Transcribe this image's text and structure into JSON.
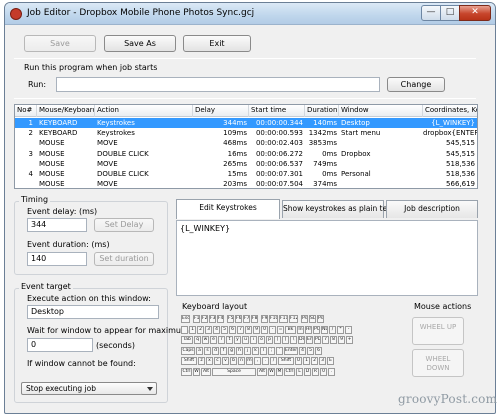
{
  "window": {
    "title": "Job Editor - Dropbox Mobile Phone Photos Sync.gcj",
    "minimize_glyph": "—",
    "maximize_glyph": "□",
    "close_glyph": "✕"
  },
  "toolbar": {
    "save_label": "Save",
    "save_as_label": "Save As",
    "exit_label": "Exit"
  },
  "run": {
    "section_label": "Run this program when job starts",
    "run_label": "Run:",
    "run_value": "",
    "change_label": "Change"
  },
  "table": {
    "columns": [
      "No#",
      "Mouse/Keyboard",
      "Action",
      "Delay",
      "Start time",
      "Duration",
      "Window",
      "Coordinates, Keys"
    ],
    "rows": [
      {
        "no": "1",
        "device": "KEYBOARD",
        "action": "Keystrokes",
        "delay": "344ms",
        "start": "00:00:00.344",
        "duration": "140ms",
        "window": "Desktop",
        "coords": "{L_WINKEY}"
      },
      {
        "no": "2",
        "device": "KEYBOARD",
        "action": "Keystrokes",
        "delay": "109ms",
        "start": "00:00:00.593",
        "duration": "1342ms",
        "window": "Start menu",
        "coords": "dropbox{ENTER}"
      },
      {
        "no": "",
        "device": "MOUSE",
        "action": "MOVE",
        "delay": "468ms",
        "start": "00:00:02.403",
        "duration": "3853ms",
        "window": "",
        "coords": "545,515"
      },
      {
        "no": "3",
        "device": "MOUSE",
        "action": "DOUBLE CLICK",
        "delay": "16ms",
        "start": "00:00:06.272",
        "duration": "0ms",
        "window": "Dropbox",
        "coords": "545,515"
      },
      {
        "no": "",
        "device": "MOUSE",
        "action": "MOVE",
        "delay": "265ms",
        "start": "00:00:06.537",
        "duration": "749ms",
        "window": "",
        "coords": "518,536"
      },
      {
        "no": "4",
        "device": "MOUSE",
        "action": "DOUBLE CLICK",
        "delay": "15ms",
        "start": "00:00:07.301",
        "duration": "0ms",
        "window": "Personal",
        "coords": "518,536"
      },
      {
        "no": "",
        "device": "MOUSE",
        "action": "MOVE",
        "delay": "203ms",
        "start": "00:00:07.504",
        "duration": "374ms",
        "window": "",
        "coords": "566,619"
      }
    ]
  },
  "timing": {
    "group_label": "Timing",
    "event_delay_label": "Event delay: (ms)",
    "event_delay_value": "344",
    "set_delay_label": "Set Delay",
    "event_duration_label": "Event duration: (ms)",
    "event_duration_value": "140",
    "set_duration_label": "Set duration"
  },
  "target": {
    "group_label": "Event target",
    "execute_label": "Execute action on this window:",
    "window_value": "Desktop",
    "wait_label": "Wait for window to appear for maximum:",
    "wait_value": "0",
    "seconds_label": "(seconds)",
    "not_found_label": "If window cannot be found:",
    "not_found_value": "Stop executing job"
  },
  "tabs": [
    "Edit Keystrokes",
    "Show keystrokes as plain text",
    "Job description"
  ],
  "keystrokes_text": "{L_WINKEY}",
  "keyboard": {
    "label": "Keyboard layout",
    "row1": [
      "Esc",
      "F1",
      "F2",
      "F3",
      "F4",
      "F5",
      "F6",
      "F7",
      "F8",
      "F9",
      "F10",
      "F11",
      "F12",
      "Ps",
      "SL",
      "Ps"
    ],
    "row2": [
      "`",
      "1",
      "2",
      "3",
      "4",
      "5",
      "6",
      "7",
      "8",
      "9",
      "0",
      "-",
      "=",
      "Bk",
      "In",
      "Hm",
      "PU",
      "NL",
      "/",
      "*",
      "-"
    ],
    "row3": [
      "Tab",
      "q",
      "w",
      "e",
      "r",
      "t",
      "y",
      "u",
      "i",
      "o",
      "p",
      "[",
      "]",
      "\\",
      "De",
      "En",
      "PD",
      "7",
      "8",
      "9",
      "+"
    ],
    "row4": [
      "Caps",
      "a",
      "s",
      "d",
      "f",
      "g",
      "h",
      "j",
      "k",
      "l",
      ";",
      "'",
      "Enter",
      "4",
      "5",
      "6"
    ],
    "row5": [
      "Shift",
      "z",
      "x",
      "c",
      "v",
      "b",
      "n",
      "m",
      ",",
      ".",
      "/",
      "Shift",
      "U",
      "1",
      "2",
      "3",
      "E"
    ],
    "row6": [
      "Ctrl",
      "W",
      "Alt",
      "Space",
      "Alt",
      "W",
      "M",
      "Ctrl",
      "L",
      "D",
      "R",
      "0",
      "."
    ]
  },
  "mouse": {
    "label": "Mouse actions",
    "wheel_up": "WHEEL UP",
    "wheel_down": "WHEEL DOWN"
  },
  "watermark": "groovyPost.com"
}
